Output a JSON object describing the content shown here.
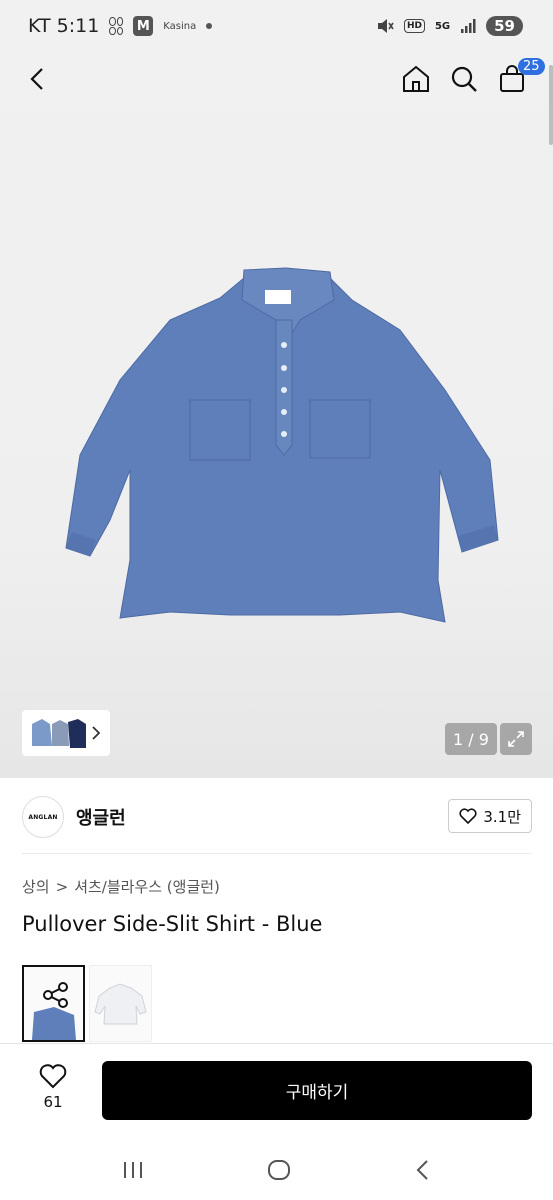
{
  "status_bar": {
    "carrier_time": "KT 5:11",
    "m_badge": "M",
    "tiny_label": "Kasina",
    "hd": "HD",
    "network": "5G",
    "battery": "59"
  },
  "top_nav": {
    "cart_count": "25",
    "icons": [
      "back-arrow-icon",
      "home-icon",
      "search-icon",
      "cart-icon"
    ]
  },
  "gallery": {
    "counter": "1 / 9",
    "product_color": "#5b7cb8"
  },
  "brand": {
    "logo_text": "ANGLAN",
    "name": "앵글런",
    "likes": "3.1만"
  },
  "breadcrumb": {
    "cat1": "상의",
    "separator": ">",
    "cat2": "셔츠/블라우스 (앵글런)"
  },
  "product": {
    "title": "Pullover Side-Slit Shirt - Blue"
  },
  "bottom_bar": {
    "wish_count": "61",
    "buy_label": "구매하기"
  },
  "colors": {
    "accent_badge": "#2f6fdf",
    "buy_button": "#000000"
  }
}
